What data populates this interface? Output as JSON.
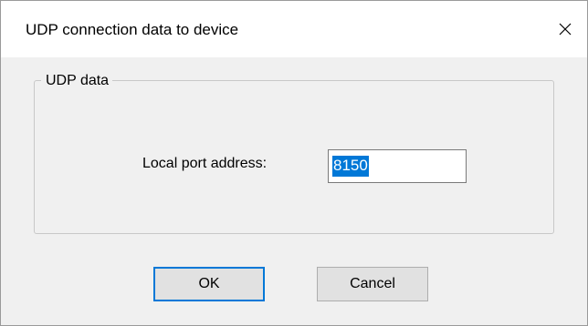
{
  "window": {
    "title": "UDP connection data to device",
    "close_icon": "close-icon"
  },
  "group": {
    "title": "UDP data",
    "port_label": "Local port address:",
    "port_value": "8150"
  },
  "buttons": {
    "ok_label": "OK",
    "cancel_label": "Cancel"
  },
  "colors": {
    "selection": "#0078d7",
    "window_bg": "#f0f0f0",
    "titlebar_bg": "#ffffff"
  }
}
